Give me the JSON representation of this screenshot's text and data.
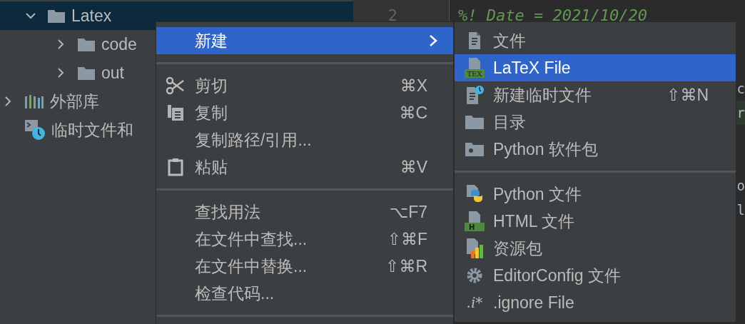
{
  "project_tree": [
    {
      "label": "Latex",
      "kind": "folder",
      "expanded": true,
      "selected": true,
      "children": [
        {
          "label": "code",
          "kind": "folder",
          "expanded": false,
          "selected": false
        },
        {
          "label": "out",
          "kind": "folder",
          "expanded": false,
          "selected": false
        }
      ]
    },
    {
      "label": "外部库",
      "kind": "library",
      "expanded": false,
      "selected": false
    },
    {
      "label": "临时文件和",
      "kind": "scratch",
      "selected": false
    }
  ],
  "editor": {
    "lines": [
      {
        "kind": "code",
        "number": "2",
        "text": "%! Date = 2021/10/20"
      },
      {
        "kind": "hidden"
      },
      {
        "kind": "hidden"
      },
      {
        "kind": "edge",
        "text": "c",
        "highlighted": false
      },
      {
        "kind": "edge",
        "text": "r",
        "highlighted": true
      },
      {
        "kind": "hidden"
      },
      {
        "kind": "hidden"
      },
      {
        "kind": "edge",
        "text": "o",
        "highlighted": false
      },
      {
        "kind": "edge",
        "text": "l",
        "highlighted": false
      }
    ]
  },
  "context_menu": {
    "items": [
      {
        "kind": "item",
        "label": "新建",
        "selected": true,
        "submenu": true
      },
      {
        "kind": "separator"
      },
      {
        "kind": "item",
        "label": "剪切",
        "shortcut": "⌘X",
        "selected": false
      },
      {
        "kind": "item",
        "label": "复制",
        "shortcut": "⌘C",
        "selected": false
      },
      {
        "kind": "item",
        "label": "复制路径/引用...",
        "selected": false
      },
      {
        "kind": "item",
        "label": "粘贴",
        "shortcut": "⌘V",
        "selected": false
      },
      {
        "kind": "separator"
      },
      {
        "kind": "item",
        "label": "查找用法",
        "shortcut": "⌥F7",
        "selected": false
      },
      {
        "kind": "item",
        "label": "在文件中查找...",
        "shortcut": "⇧⌘F",
        "selected": false
      },
      {
        "kind": "item",
        "label": "在文件中替换...",
        "shortcut": "⇧⌘R",
        "selected": false
      },
      {
        "kind": "item",
        "label": "检查代码...",
        "selected": false
      },
      {
        "kind": "separator"
      }
    ]
  },
  "submenu": {
    "items": [
      {
        "kind": "item",
        "label": "文件",
        "selected": false
      },
      {
        "kind": "item",
        "icon_text": "TEX",
        "label": "LaTeX File",
        "selected": true
      },
      {
        "kind": "item",
        "label": "新建临时文件",
        "shortcut": "⇧⌘N",
        "selected": false
      },
      {
        "kind": "item",
        "label": "目录",
        "selected": false
      },
      {
        "kind": "item",
        "label": "Python 软件包",
        "selected": false
      },
      {
        "kind": "separator"
      },
      {
        "kind": "item",
        "label": "Python 文件",
        "selected": false
      },
      {
        "kind": "item",
        "icon_text": "H",
        "label": "HTML 文件",
        "selected": false
      },
      {
        "kind": "item",
        "label": "资源包",
        "selected": false
      },
      {
        "kind": "item",
        "label": "EditorConfig 文件",
        "selected": false
      },
      {
        "kind": "item",
        "icon_text": ".i*",
        "label": ".ignore File",
        "selected": false
      }
    ]
  }
}
